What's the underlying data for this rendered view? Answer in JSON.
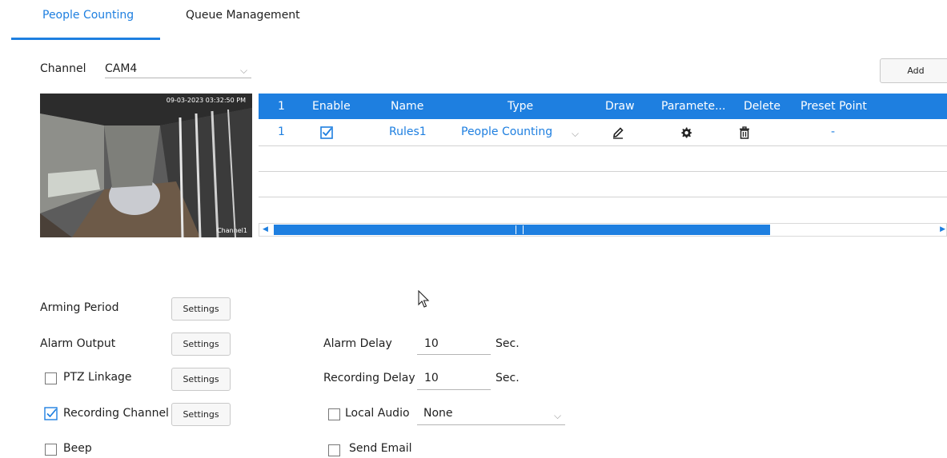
{
  "tabs": [
    {
      "label": "People Counting",
      "active": true
    },
    {
      "label": "Queue Management",
      "active": false
    }
  ],
  "channel": {
    "label": "Channel",
    "value": "CAM4"
  },
  "add_button": "Add",
  "video": {
    "timestamp": "09-03-2023 03:32:50 PM",
    "channel_label": "Channel1"
  },
  "table": {
    "headers": [
      "1",
      "Enable",
      "Name",
      "Type",
      "Draw",
      "Paramete...",
      "Delete",
      "Preset Point"
    ],
    "rows": [
      {
        "index": "1",
        "enabled": true,
        "name": "Rules1",
        "type": "People Counting",
        "preset": "-"
      }
    ]
  },
  "settings": {
    "arming_period": "Arming Period",
    "alarm_output": "Alarm Output",
    "ptz_linkage": {
      "label": "PTZ Linkage",
      "checked": false
    },
    "recording_channel": {
      "label": "Recording Channel",
      "checked": true
    },
    "beep": {
      "label": "Beep",
      "checked": false
    },
    "settings_button": "Settings",
    "alarm_delay": {
      "label": "Alarm Delay",
      "value": "10",
      "unit": "Sec."
    },
    "recording_delay": {
      "label": "Recording Delay",
      "value": "10",
      "unit": "Sec."
    },
    "local_audio": {
      "label": "Local Audio",
      "checked": false,
      "value": "None"
    },
    "send_email": {
      "label": "Send Email",
      "checked": false
    }
  },
  "colors": {
    "accent": "#1e7fe0"
  }
}
